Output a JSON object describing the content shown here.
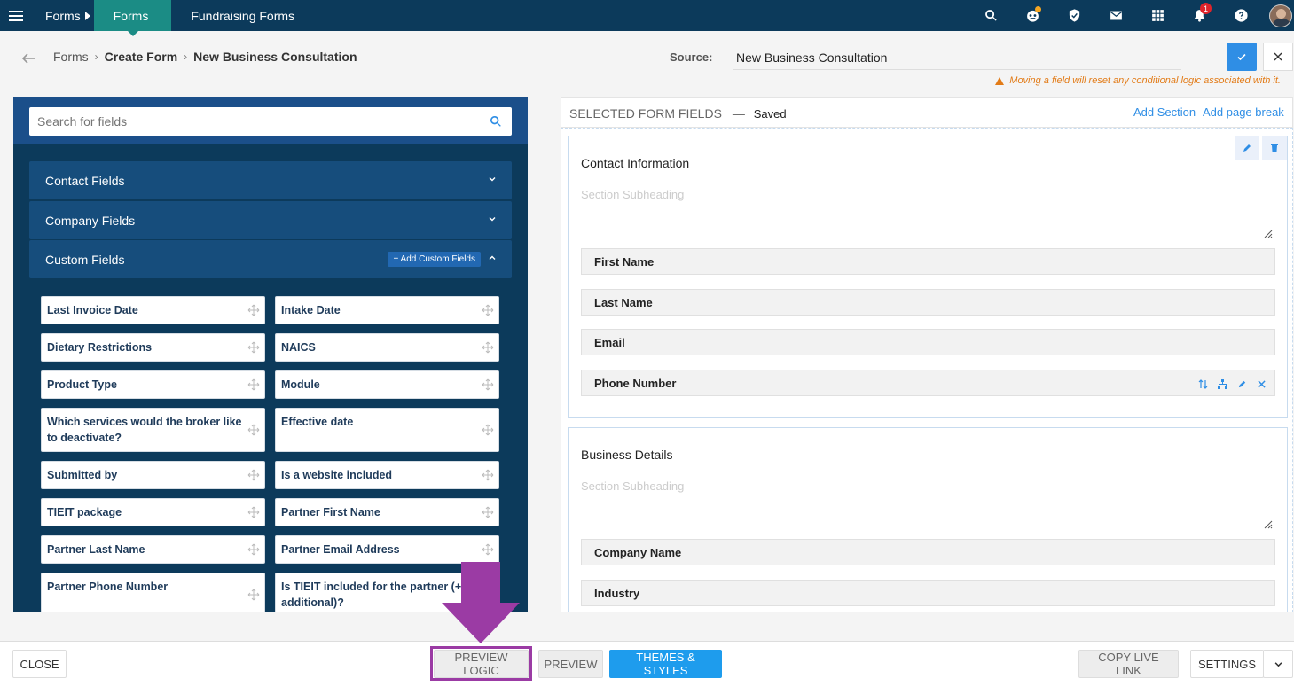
{
  "topbar": {
    "menu_icon": "hamburger-icon",
    "crumb": "Forms",
    "active_tab": "Forms",
    "tab": "Fundraising Forms",
    "icons": [
      "search-icon",
      "bot-icon",
      "shield-icon",
      "mail-icon",
      "apps-grid-icon",
      "bell-icon",
      "help-icon",
      "user-avatar"
    ],
    "notification_count": "1"
  },
  "breadcrumb": {
    "items": [
      "Forms",
      "Create Form",
      "New Business Consultation"
    ]
  },
  "source": {
    "label": "Source:",
    "value": "New Business Consultation"
  },
  "warning": "Moving a field will reset any conditional logic associated with it.",
  "left_panel": {
    "search_placeholder": "Search for fields",
    "groups": [
      "Contact Fields",
      "Company Fields",
      "Custom Fields"
    ],
    "add_custom_label": "+ Add Custom Fields",
    "custom_fields": [
      "Last Invoice Date",
      "Intake Date",
      "Dietary Restrictions",
      "NAICS",
      "Product Type",
      "Module",
      "Which services would the broker like to deactivate?",
      "Effective date",
      "Submitted by",
      "Is a website included",
      "TIEIT package",
      "Partner First Name",
      "Partner Last Name",
      "Partner Email Address",
      "Partner Phone Number",
      "Is TIEIT included for the partner (+$3 additional)?"
    ]
  },
  "right_panel": {
    "title": "SELECTED FORM FIELDS",
    "dash": "—",
    "status": "Saved",
    "add_section": "Add Section",
    "add_page_break": "Add page break",
    "sections": [
      {
        "title": "Contact Information",
        "subheading_placeholder": "Section Subheading",
        "fields": [
          "First Name",
          "Last Name",
          "Email",
          "Phone Number"
        ]
      },
      {
        "title": "Business Details",
        "subheading_placeholder": "Section Subheading",
        "fields": [
          "Company Name",
          "Industry"
        ]
      }
    ]
  },
  "bottombar": {
    "close": "CLOSE",
    "preview_logic": "PREVIEW LOGIC",
    "preview": "PREVIEW",
    "themes": "THEMES & STYLES",
    "copy_link": "COPY LIVE LINK",
    "settings": "SETTINGS"
  },
  "colors": {
    "topbar": "#0c3a5b",
    "active_tab": "#1b8c85",
    "accent_blue": "#1e9ced",
    "annotation": "#9b3ba4",
    "warning": "#e27b17"
  }
}
